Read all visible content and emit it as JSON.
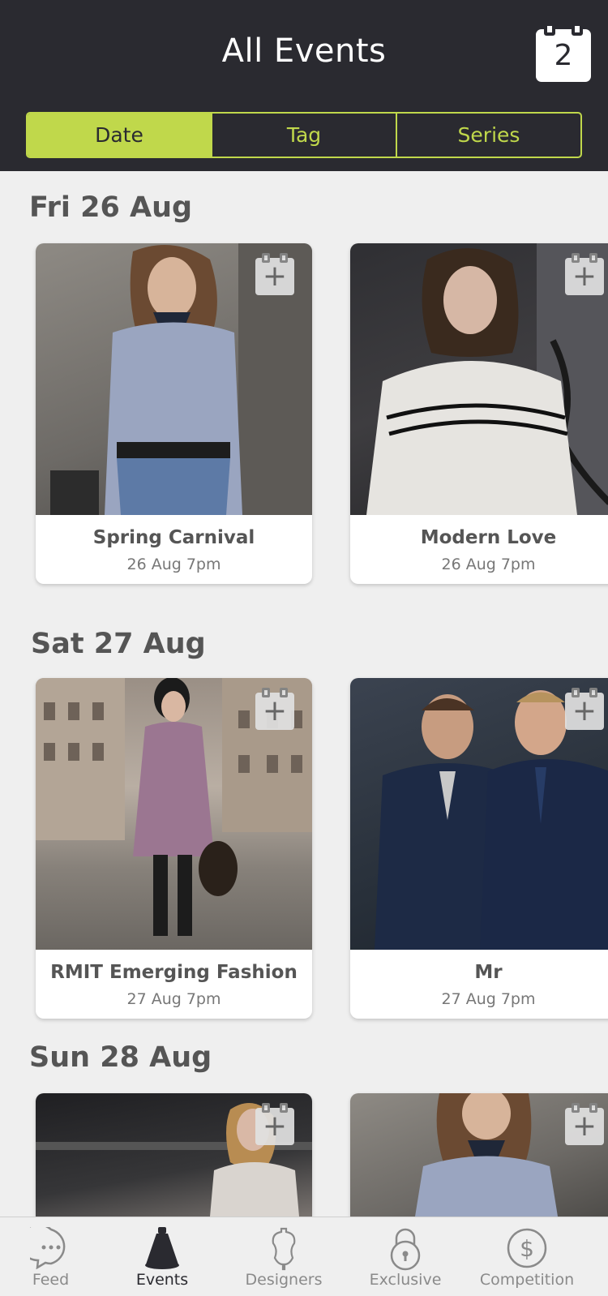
{
  "header": {
    "title": "All Events",
    "calendar_count": "2"
  },
  "segments": [
    {
      "label": "Date",
      "active": true
    },
    {
      "label": "Tag",
      "active": false
    },
    {
      "label": "Series",
      "active": false
    }
  ],
  "sections": [
    {
      "heading": "Fri 26 Aug",
      "events": [
        {
          "title": "Spring Carnival",
          "time": "26 Aug 7pm"
        },
        {
          "title": "Modern Love",
          "time": "26 Aug 7pm"
        }
      ]
    },
    {
      "heading": "Sat 27 Aug",
      "events": [
        {
          "title": "RMIT Emerging Fashion",
          "time": "27 Aug 7pm"
        },
        {
          "title": "Mr",
          "time": "27 Aug 7pm"
        }
      ]
    },
    {
      "heading": "Sun 28 Aug",
      "events": [
        {
          "title": "",
          "time": ""
        },
        {
          "title": "",
          "time": ""
        }
      ]
    }
  ],
  "tabbar": {
    "items": [
      {
        "label": "Feed",
        "icon": "speech-bubble-icon",
        "active": false
      },
      {
        "label": "Events",
        "icon": "spotlight-icon",
        "active": true
      },
      {
        "label": "Designers",
        "icon": "dress-form-icon",
        "active": false
      },
      {
        "label": "Exclusive",
        "icon": "padlock-icon",
        "active": false
      },
      {
        "label": "Competition",
        "icon": "dollar-icon",
        "active": false
      }
    ]
  },
  "colors": {
    "header_bg": "#2a2a30",
    "accent": "#c0d84b",
    "page_bg": "#efefef"
  }
}
